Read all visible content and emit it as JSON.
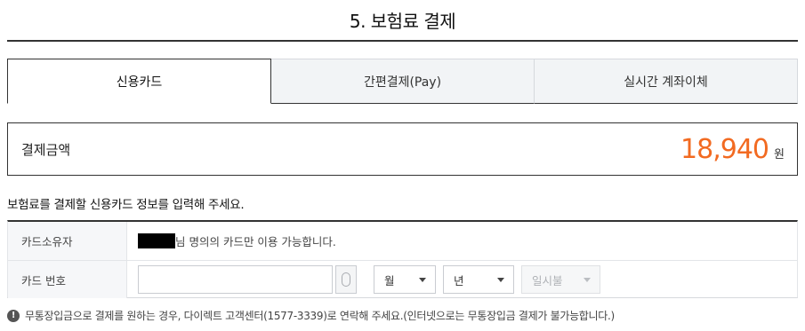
{
  "section_title": "5. 보험료 결제",
  "tabs": [
    {
      "label": "신용카드",
      "active": true
    },
    {
      "label": "간편결제(Pay)",
      "active": false
    },
    {
      "label": "실시간 계좌이체",
      "active": false
    }
  ],
  "amount": {
    "label": "결제금액",
    "value": "18,940",
    "unit": "원",
    "color": "#f26a21"
  },
  "instruction": "보험료를 결제할 신용카드 정보를 입력해 주세요.",
  "card_owner": {
    "label": "카드소유자",
    "text": "님 명의의 카드만 이용 가능합니다."
  },
  "card_number": {
    "label": "카드 번호",
    "input_value": "",
    "month_select": "월",
    "year_select": "년",
    "installment_select": "일시불"
  },
  "notice": {
    "icon": "exclamation-circle-icon",
    "text": "무통장입금으로 결제를 원하는 경우, 다이렉트 고객센터(1577-3339)로 연락해 주세요.(인터넷으로는 무통장입금 결제가 불가능합니다.)"
  }
}
